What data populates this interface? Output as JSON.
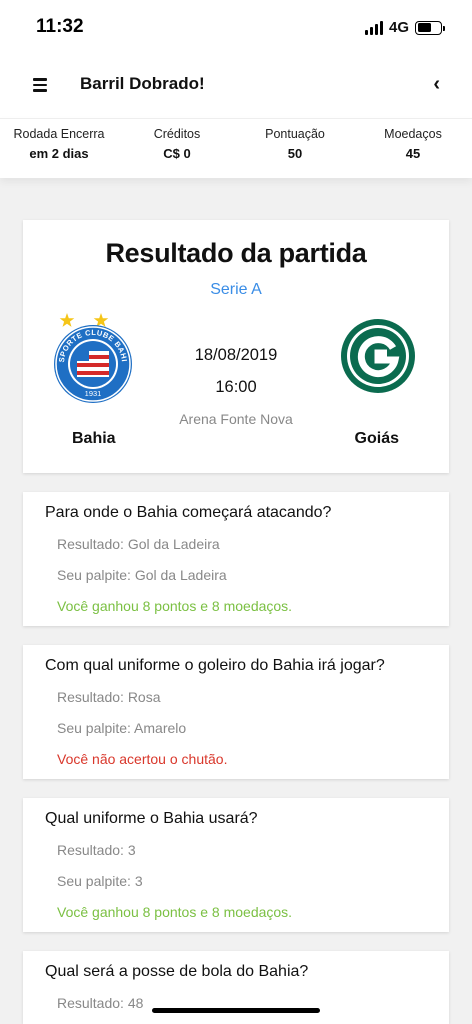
{
  "status_bar": {
    "time": "11:32",
    "network": "4G",
    "icons": [
      "signal-icon",
      "battery-icon"
    ]
  },
  "header": {
    "title": "Barril Dobrado!",
    "menu_icon": "hamburger-menu-icon",
    "back_icon": "chevron-left-icon"
  },
  "stats": [
    {
      "label": "Rodada Encerra",
      "value": "em 2 dias"
    },
    {
      "label": "Créditos",
      "value": "C$ 0"
    },
    {
      "label": "Pontuação",
      "value": "50"
    },
    {
      "label": "Moedaços",
      "value": "45"
    }
  ],
  "match": {
    "title": "Resultado da partida",
    "league": "Serie A",
    "date": "18/08/2019",
    "time": "16:00",
    "venue": "Arena Fonte Nova",
    "home_team": "Bahia",
    "away_team": "Goiás",
    "home_crest_text": "ESPORTE CLUBE BAHIA",
    "home_crest_year": "1931",
    "colors": {
      "league": "#3a8de6",
      "bahia_blue": "#1f6fc4",
      "bahia_red": "#d42a2a",
      "star": "#f5c518",
      "goias_green": "#0b6b4f"
    }
  },
  "questions": [
    {
      "question": "Para onde o Bahia começará atacando?",
      "result_label": "Resultado: Gol da Ladeira",
      "guess_label": "Seu palpite: Gol da Ladeira",
      "outcome": "Você ganhou 8 pontos e 8 moedaços.",
      "outcome_type": "win"
    },
    {
      "question": "Com qual uniforme o goleiro do Bahia irá jogar?",
      "result_label": "Resultado: Rosa",
      "guess_label": "Seu palpite: Amarelo",
      "outcome": "Você não acertou o chutão.",
      "outcome_type": "lose"
    },
    {
      "question": "Qual uniforme o Bahia usará?",
      "result_label": "Resultado: 3",
      "guess_label": "Seu palpite: 3",
      "outcome": "Você ganhou 8 pontos e 8 moedaços.",
      "outcome_type": "win"
    },
    {
      "question": "Qual será a posse de bola do Bahia?",
      "result_label": "Resultado: 48"
    }
  ],
  "status_colors": {
    "win": "#7bc043",
    "lose": "#d9372b"
  }
}
